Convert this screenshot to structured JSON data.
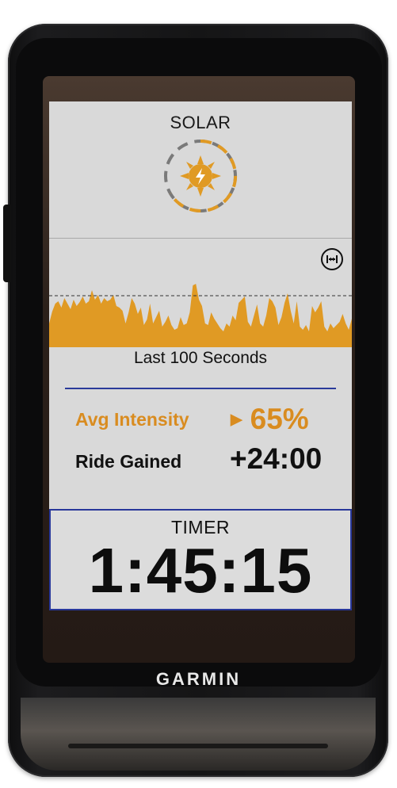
{
  "device": {
    "brand": "GARMIN"
  },
  "solar": {
    "title": "SOLAR",
    "icon": "sun-lightning-icon",
    "color": "#d98c20"
  },
  "chart_data": {
    "type": "area",
    "title": "",
    "caption": "Last 100 Seconds",
    "xlabel": "",
    "ylabel": "",
    "x_range": [
      0,
      100
    ],
    "ylim": [
      0,
      100
    ],
    "reference_line": 65,
    "color": "#e09a24",
    "values": [
      30,
      45,
      55,
      58,
      50,
      62,
      55,
      48,
      60,
      52,
      57,
      64,
      55,
      58,
      72,
      60,
      66,
      55,
      62,
      58,
      60,
      66,
      52,
      50,
      46,
      30,
      44,
      62,
      55,
      42,
      50,
      28,
      35,
      55,
      30,
      38,
      46,
      26,
      32,
      40,
      28,
      22,
      24,
      38,
      28,
      30,
      44,
      78,
      80,
      60,
      52,
      30,
      28,
      44,
      36,
      30,
      24,
      20,
      30,
      26,
      40,
      34,
      56,
      60,
      64,
      32,
      26,
      40,
      54,
      30,
      26,
      40,
      62,
      58,
      50,
      28,
      38,
      56,
      68,
      46,
      30,
      58,
      26,
      22,
      28,
      20,
      52,
      44,
      50,
      58,
      26,
      20,
      30,
      24,
      28,
      32,
      42,
      30,
      22,
      36
    ]
  },
  "metrics": {
    "avg_intensity": {
      "label": "Avg Intensity",
      "value": "65%",
      "indicator": "▶",
      "color": "#d98c20"
    },
    "ride_gained": {
      "label": "Ride Gained",
      "value": "+24:00"
    }
  },
  "timer": {
    "label": "TIMER",
    "value": "1:45:15"
  },
  "colors": {
    "screen_bg": "#d9d9d9",
    "accent_blue": "#28379a",
    "orange": "#d98c20"
  }
}
